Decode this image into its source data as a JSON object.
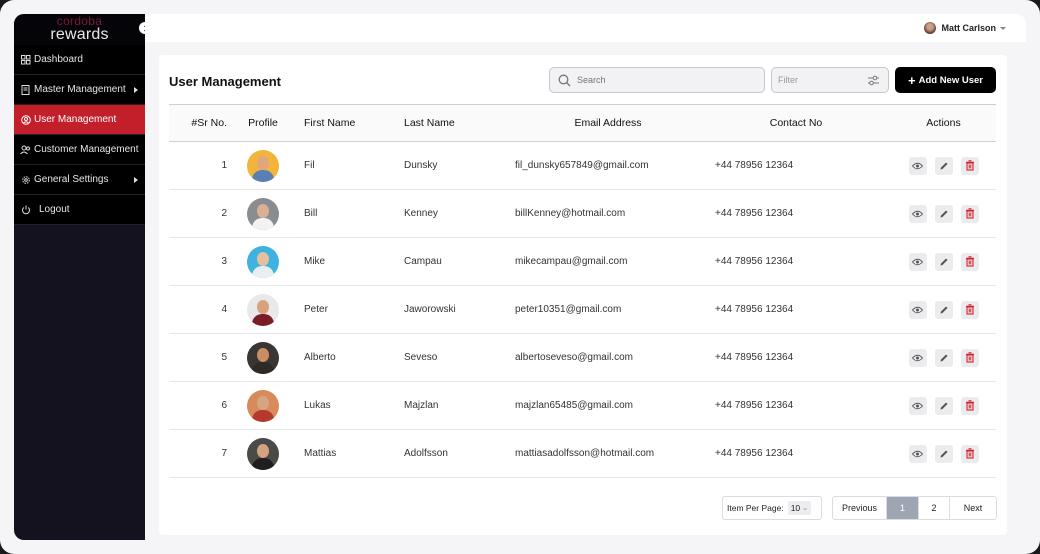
{
  "brand": {
    "line1": "cordoba",
    "line2": "rewards"
  },
  "sidebar": {
    "items": [
      {
        "label": "Dashboard",
        "icon": "grid-icon",
        "active": false,
        "submenu": false
      },
      {
        "label": "Master Management",
        "icon": "document-icon",
        "active": false,
        "submenu": true
      },
      {
        "label": "User Management",
        "icon": "user-circle-icon",
        "active": true,
        "submenu": false
      },
      {
        "label": "Customer Management",
        "icon": "users-icon",
        "active": false,
        "submenu": false
      },
      {
        "label": "General Settings",
        "icon": "gear-icon",
        "active": false,
        "submenu": true
      },
      {
        "label": "Logout",
        "icon": "power-icon",
        "active": false,
        "submenu": false
      }
    ]
  },
  "header": {
    "user_name": "Matt Carlson"
  },
  "page": {
    "title": "User Management",
    "search_placeholder": "Search",
    "filter_placeholder": "Filter",
    "add_button": "Add New User"
  },
  "table": {
    "columns": [
      "#Sr No.",
      "Profile",
      "First Name",
      "Last Name",
      "Email Address",
      "Contact No",
      "Actions"
    ],
    "rows": [
      {
        "sr": "1",
        "first": "Fil",
        "last": "Dunsky",
        "email": "fil_dunsky657849@gmail.com",
        "contact": "+44 78956 12364",
        "avatar_bg": "#f2b53a",
        "skin": "#e0a67f",
        "shirt": "#5a7fb5"
      },
      {
        "sr": "2",
        "first": "Bill",
        "last": "Kenney",
        "email": "billKenney@hotmail.com",
        "contact": "+44 78956 12364",
        "avatar_bg": "#8a8d90",
        "skin": "#d9b094",
        "shirt": "#f2f2f2"
      },
      {
        "sr": "3",
        "first": "Mike",
        "last": "Campau",
        "email": "mikecampau@gmail.com",
        "contact": "+44 78956 12364",
        "avatar_bg": "#3eb3e0",
        "skin": "#e6bf9f",
        "shirt": "#e8eef2"
      },
      {
        "sr": "4",
        "first": "Peter",
        "last": "Jaworowski",
        "email": "peter10351@gmail.com",
        "contact": "+44 78956 12364",
        "avatar_bg": "#e9e9ea",
        "skin": "#d9a27e",
        "shirt": "#7a1d26"
      },
      {
        "sr": "5",
        "first": "Alberto",
        "last": "Seveso",
        "email": "albertoseveso@gmail.com",
        "contact": "+44 78956 12364",
        "avatar_bg": "#3b3633",
        "skin": "#c98f62",
        "shirt": "#2d2a28"
      },
      {
        "sr": "6",
        "first": "Lukas",
        "last": "Majzlan",
        "email": "majzlan65485@gmail.com",
        "contact": "+44 78956 12364",
        "avatar_bg": "#d98a5a",
        "skin": "#d7a584",
        "shirt": "#b33a2c"
      },
      {
        "sr": "7",
        "first": "Mattias",
        "last": "Adolfsson",
        "email": "mattiasadolfsson@hotmail.com",
        "contact": "+44 78956 12364",
        "avatar_bg": "#4b4a46",
        "skin": "#d2a283",
        "shirt": "#1e1e1e"
      }
    ]
  },
  "pagination": {
    "per_page_label": "Item Per Page:",
    "per_page_value": "10",
    "previous": "Previous",
    "pages": [
      "1",
      "2"
    ],
    "current_page": "1",
    "next": "Next"
  },
  "colors": {
    "accent": "#c21f2a",
    "sidebar_bg": "#000000",
    "pager_active": "#9ea6b3"
  }
}
